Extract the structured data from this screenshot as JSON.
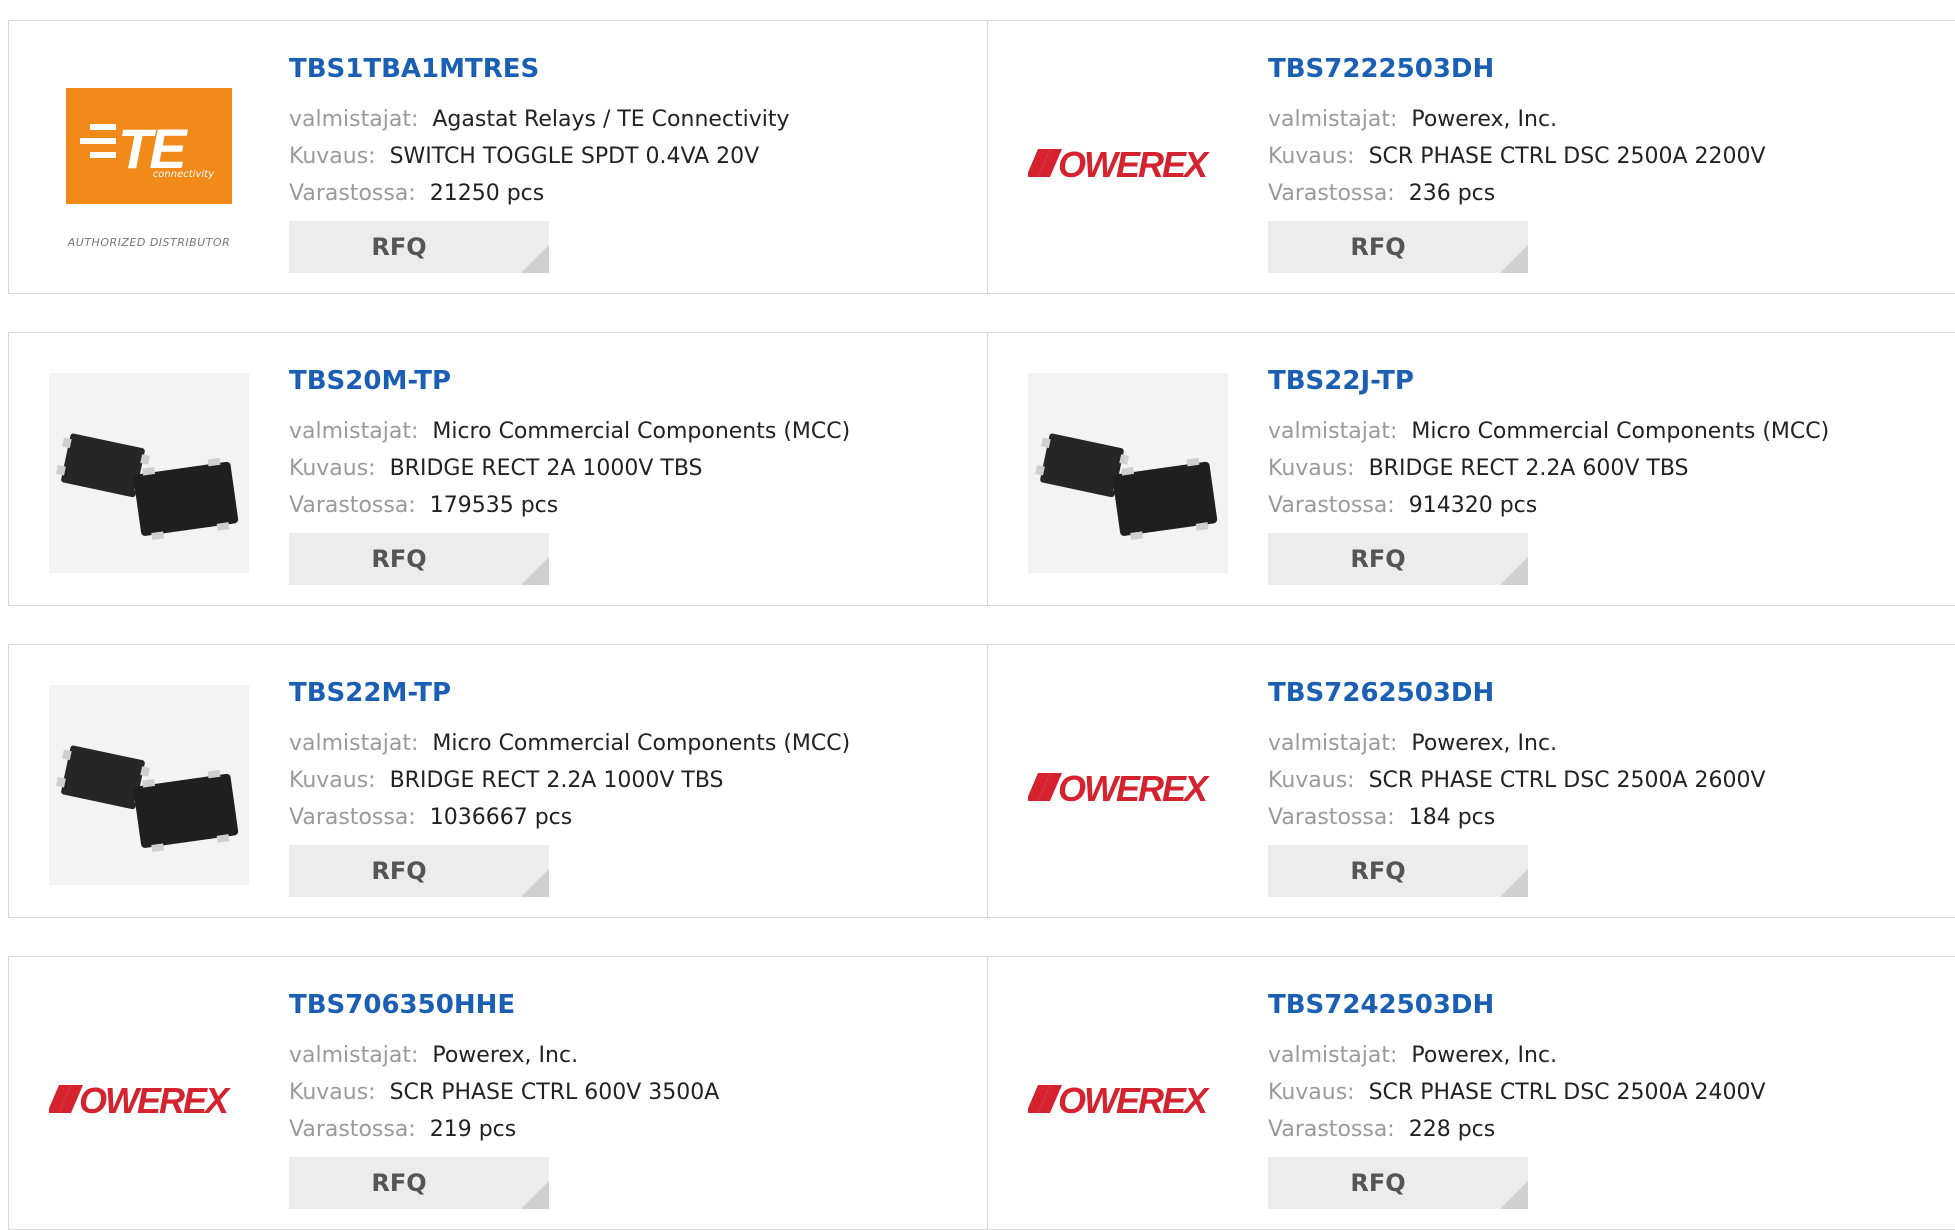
{
  "colors": {
    "link": "#1a5fb4",
    "label": "#9a9a9a",
    "rfq_bg": "#ececec",
    "powerex_red": "#d4232f",
    "te_orange": "#f28a1a"
  },
  "labels": {
    "manufacturer": "valmistajat:",
    "description": "Kuvaus:",
    "stock": "Varastossa:",
    "rfq": "RFQ"
  },
  "logos": {
    "te": {
      "text": "TE",
      "sub": "connectivity",
      "badge": "AUTHORIZED DISTRIBUTOR"
    },
    "powerex": {
      "text": "POWEREX"
    }
  },
  "products": [
    {
      "part": "TBS1TBA1MTRES",
      "manufacturer": "Agastat Relays / TE Connectivity",
      "description": "SWITCH TOGGLE SPDT 0.4VA 20V",
      "stock": "21250 pcs",
      "image": "te-logo"
    },
    {
      "part": "TBS7222503DH",
      "manufacturer": "Powerex, Inc.",
      "description": "SCR PHASE CTRL DSC 2500A 2200V",
      "stock": "236 pcs",
      "image": "powerex-logo"
    },
    {
      "part": "TBS20M-TP",
      "manufacturer": "Micro Commercial Components (MCC)",
      "description": "BRIDGE RECT 2A 1000V TBS",
      "stock": "179535 pcs",
      "image": "chip-photo"
    },
    {
      "part": "TBS22J-TP",
      "manufacturer": "Micro Commercial Components (MCC)",
      "description": "BRIDGE RECT 2.2A 600V TBS",
      "stock": "914320 pcs",
      "image": "chip-photo"
    },
    {
      "part": "TBS22M-TP",
      "manufacturer": "Micro Commercial Components (MCC)",
      "description": "BRIDGE RECT 2.2A 1000V TBS",
      "stock": "1036667 pcs",
      "image": "chip-photo"
    },
    {
      "part": "TBS7262503DH",
      "manufacturer": "Powerex, Inc.",
      "description": "SCR PHASE CTRL DSC 2500A 2600V",
      "stock": "184 pcs",
      "image": "powerex-logo"
    },
    {
      "part": "TBS706350HHE",
      "manufacturer": "Powerex, Inc.",
      "description": "SCR PHASE CTRL 600V 3500A",
      "stock": "219 pcs",
      "image": "powerex-logo"
    },
    {
      "part": "TBS7242503DH",
      "manufacturer": "Powerex, Inc.",
      "description": "SCR PHASE CTRL DSC 2500A 2400V",
      "stock": "228 pcs",
      "image": "powerex-logo"
    }
  ]
}
